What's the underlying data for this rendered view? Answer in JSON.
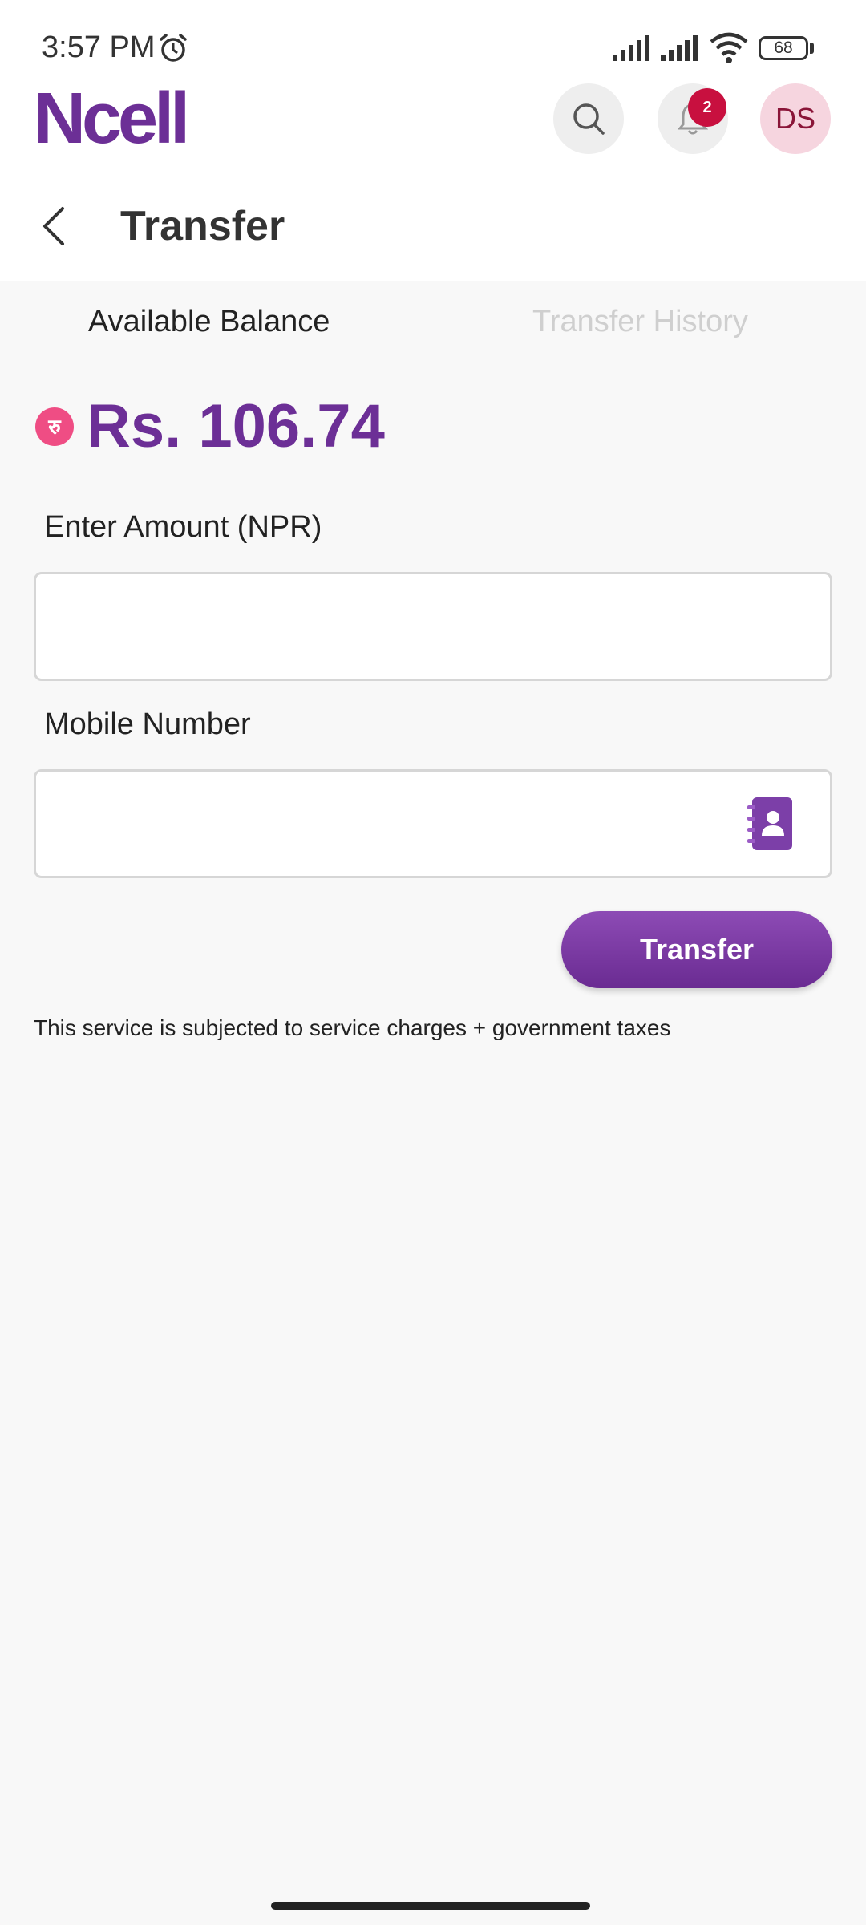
{
  "status_bar": {
    "time": "3:57 PM",
    "battery": "68",
    "icons": [
      "alarm-icon",
      "signal-icon",
      "signal-icon",
      "wifi-icon",
      "battery-icon"
    ]
  },
  "header": {
    "logo": "Ncell",
    "notification_count": "2",
    "avatar_initials": "DS"
  },
  "page": {
    "title": "Transfer"
  },
  "tabs": [
    {
      "label": "Available Balance",
      "active": true
    },
    {
      "label": "Transfer History",
      "active": false
    }
  ],
  "balance": {
    "currency_symbol": "रु",
    "amount": "Rs. 106.74"
  },
  "form": {
    "amount_label": "Enter Amount (NPR)",
    "amount_value": "",
    "mobile_label": "Mobile Number",
    "mobile_value": "",
    "submit_label": "Transfer"
  },
  "note": "This service is subjected to service charges + government taxes",
  "colors": {
    "brand": "#6c2f96",
    "badge": "#c8103f",
    "avatar_bg": "#f6d5df",
    "background": "#f8f8f8"
  }
}
